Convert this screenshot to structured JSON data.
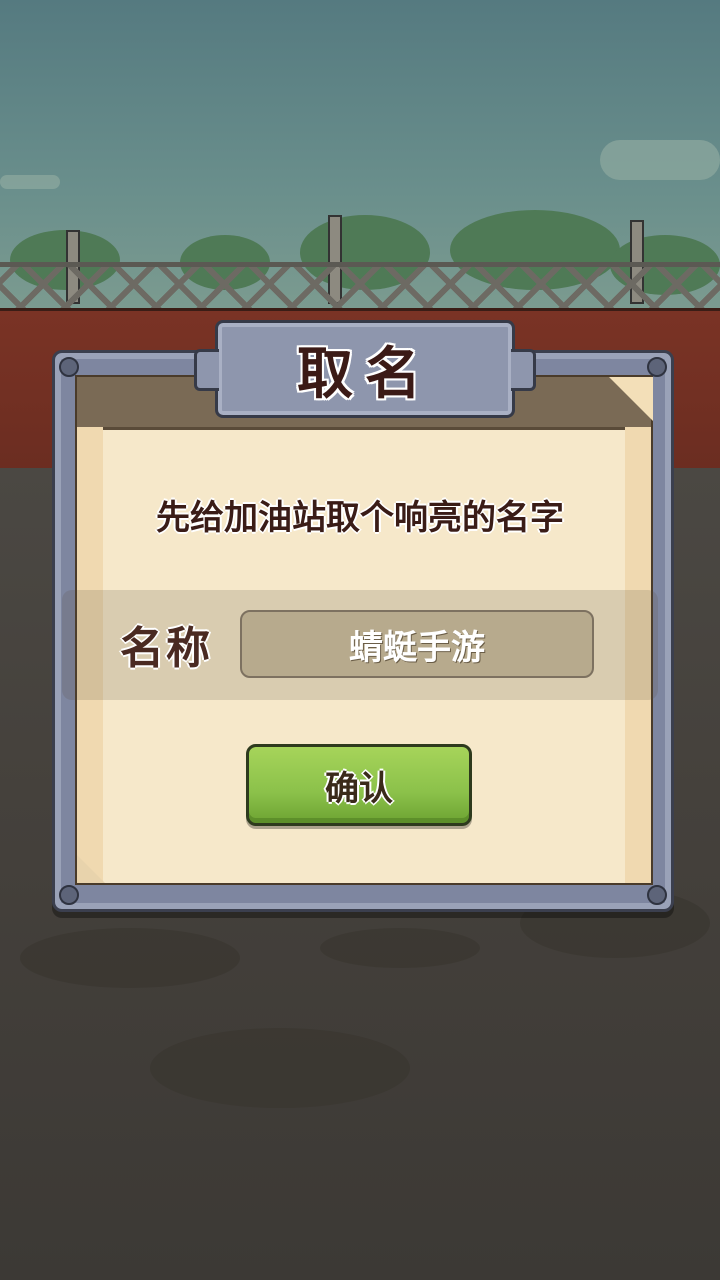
{
  "dialog": {
    "title": "取名",
    "prompt": "先给加油站取个响亮的名字",
    "name_label": "名称",
    "name_value": "蜻蜓手游",
    "confirm_label": "确认"
  }
}
